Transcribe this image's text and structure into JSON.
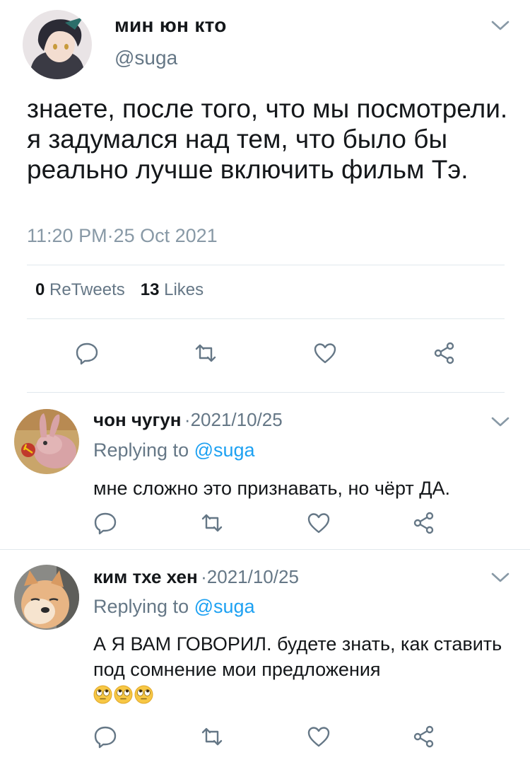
{
  "main_tweet": {
    "display_name": "мин юн кто",
    "handle": "@suga",
    "text": "знаете, после того, что мы посмотрели. я задумался над тем, что было бы реально лучше включить фильм Тэ.",
    "timestamp": "11:20 PM·25 Oct 2021",
    "retweets_count": "0",
    "retweets_label": "ReTweets",
    "likes_count": "13",
    "likes_label": "Likes"
  },
  "replies": [
    {
      "display_name": "чон чугун",
      "date": "·2021/10/25",
      "replying_prefix": "Replying to ",
      "replying_handle": "@suga",
      "text": "мне сложно это признавать, но чёрт ДА."
    },
    {
      "display_name": "ким тхе хен",
      "date": "·2021/10/25",
      "replying_prefix": "Replying to ",
      "replying_handle": "@suga",
      "text": "А Я ВАМ ГОВОРИЛ. будете знать, как ставить под сомнение мои предложения",
      "emoji": [
        "rolling-eyes-emoji",
        "rolling-eyes-emoji",
        "rolling-eyes-emoji"
      ]
    }
  ],
  "colors": {
    "text": "#14171a",
    "secondary": "#657786",
    "link": "#1da1f2",
    "divider": "#e1e8ed"
  }
}
